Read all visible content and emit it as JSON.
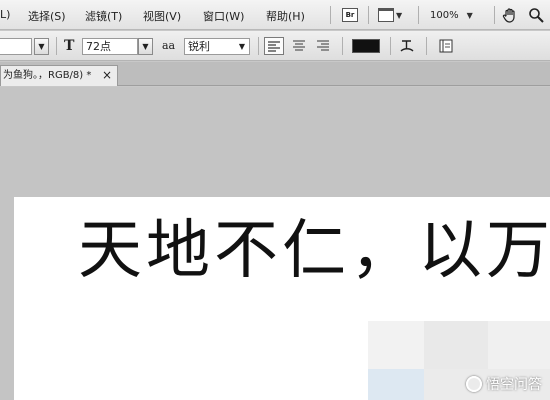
{
  "menubar": {
    "items": [
      "L)",
      "选择(S)",
      "滤镜(T)",
      "视图(V)",
      "窗口(W)",
      "帮助(H)"
    ],
    "zoom": "100%",
    "app_icon": "Br"
  },
  "options": {
    "font_style_placeholder": "",
    "text_orientation_icon": "text-orientation-icon",
    "font_size": "72点",
    "aa_label": "aa",
    "antialias": "锐利",
    "align_buttons": [
      "align-left-icon",
      "align-center-icon",
      "align-right-icon"
    ],
    "text_color": "#111111"
  },
  "document": {
    "tab_title": "为鱼狗。，RGB/8) *",
    "close_label": "×",
    "text": "天地不仁，以万"
  },
  "watermark": {
    "text": "悟空问答"
  },
  "colors": {
    "canvas_bg": "#c4c4c4",
    "doc_bg": "#ffffff"
  }
}
